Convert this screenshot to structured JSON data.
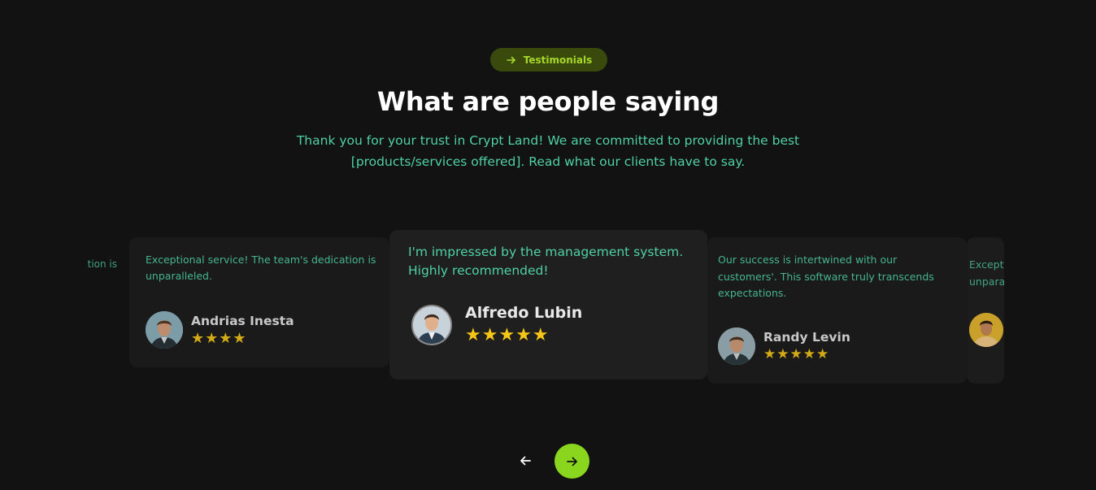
{
  "section": {
    "badge_label": "Testimonials",
    "heading": "What are people saying",
    "subtitle_line1": "Thank you for your trust in Crypt Land! We are committed to providing the best",
    "subtitle_line2": "[products/services offered]. Read what our clients have to say."
  },
  "testimonials": {
    "edge_left": {
      "quote": "tion is"
    },
    "left": {
      "quote": "Exceptional service! The team's dedication is unparalleled.",
      "name": "Andrias Inesta",
      "stars": "★★★★",
      "rating": 4
    },
    "center": {
      "quote": "I'm impressed by the management system. Highly recommended!",
      "name": "Alfredo Lubin",
      "stars": "★★★★★",
      "rating": 5
    },
    "right": {
      "quote": "Our success is intertwined with our customers'. This software truly transcends expectations.",
      "name": "Randy Levin",
      "stars": "★★★★★",
      "rating": 5
    },
    "edge_right": {
      "quote_line1": "Excepti",
      "quote_line2": "unparall"
    }
  },
  "colors": {
    "background": "#121212",
    "accent_green": "#8ad61f",
    "quote_teal": "#4fd1a5",
    "star_gold": "#f5c518"
  },
  "icons": {
    "badge": "arrow-right-icon",
    "prev": "arrow-left-icon",
    "next": "arrow-right-icon"
  }
}
